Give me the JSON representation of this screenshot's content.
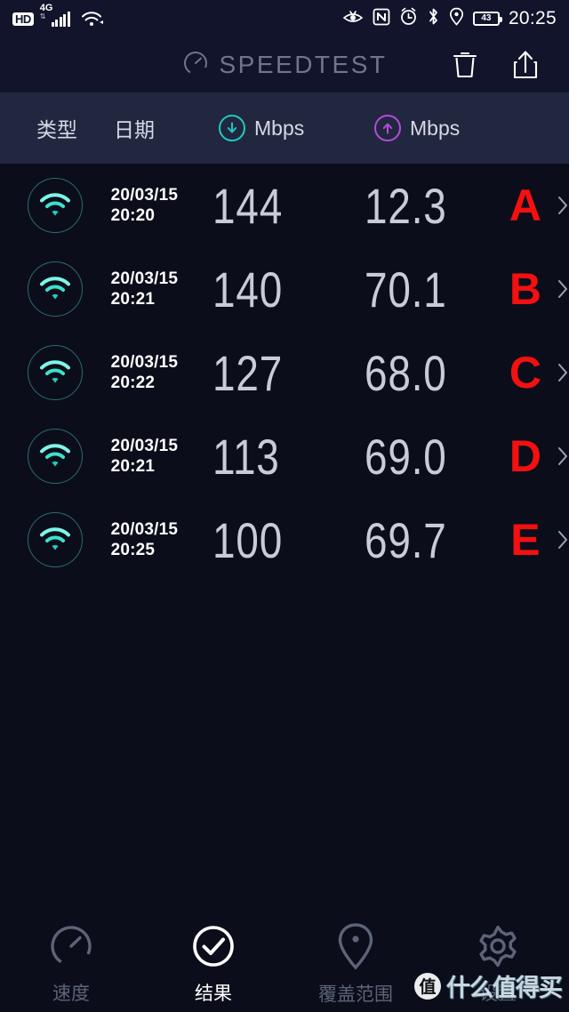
{
  "statusbar": {
    "hd_badge": "HD",
    "network_type": "4G",
    "network_sub": "↕",
    "battery_level": "43",
    "time": "20:25",
    "icons": [
      "eye-care-icon",
      "nfc-icon",
      "alarm-icon",
      "bluetooth-icon",
      "location-icon",
      "battery-icon"
    ]
  },
  "appbar": {
    "title": "SPEEDTEST",
    "gauge_icon": "speedometer-icon",
    "delete_label": "delete",
    "share_label": "share"
  },
  "columns": {
    "type": "类型",
    "date": "日期",
    "download": "Mbps",
    "upload": "Mbps",
    "download_color": "#25c8c0",
    "upload_color": "#b44ae0"
  },
  "results": [
    {
      "connection": "wifi",
      "date": "20/03/15",
      "time": "20:20",
      "download": "144",
      "upload": "12.3",
      "grade": "A"
    },
    {
      "connection": "wifi",
      "date": "20/03/15",
      "time": "20:21",
      "download": "140",
      "upload": "70.1",
      "grade": "B"
    },
    {
      "connection": "wifi",
      "date": "20/03/15",
      "time": "20:22",
      "download": "127",
      "upload": "68.0",
      "grade": "C"
    },
    {
      "connection": "wifi",
      "date": "20/03/15",
      "time": "20:21",
      "download": "113",
      "upload": "69.0",
      "grade": "D"
    },
    {
      "connection": "wifi",
      "date": "20/03/15",
      "time": "20:25",
      "download": "100",
      "upload": "69.7",
      "grade": "E"
    }
  ],
  "grade_color": "#f41010",
  "bottom_nav": [
    {
      "label": "速度",
      "icon": "speedometer-icon",
      "active": false
    },
    {
      "label": "结果",
      "icon": "check-circle-icon",
      "active": true
    },
    {
      "label": "覆盖范围",
      "icon": "map-pin-icon",
      "active": false
    },
    {
      "label": "设置",
      "icon": "gear-icon",
      "active": false
    }
  ],
  "watermark": {
    "logo": "值",
    "text": "什么值得买"
  }
}
